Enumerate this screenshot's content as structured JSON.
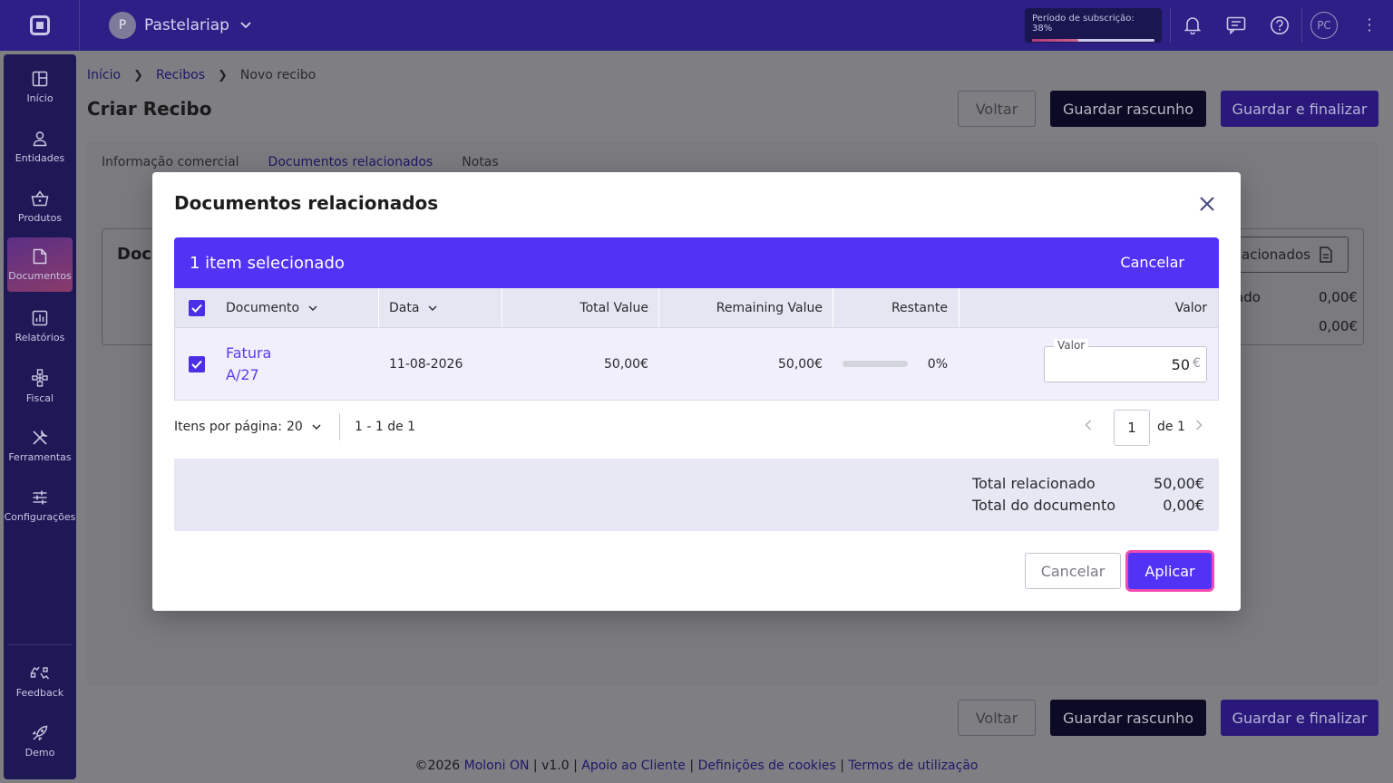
{
  "topbar": {
    "company_initial": "P",
    "company_name": "Pastelariap",
    "subscription_label": "Período de subscrição: 38%",
    "subscription_progress": 0.38,
    "user_initials": "PC"
  },
  "sidebar": {
    "items": [
      {
        "label": "Início",
        "icon": "dashboard-icon"
      },
      {
        "label": "Entidades",
        "icon": "user-icon"
      },
      {
        "label": "Produtos",
        "icon": "basket-icon"
      },
      {
        "label": "Documentos",
        "icon": "document-icon"
      },
      {
        "label": "Relatórios",
        "icon": "chart-icon"
      },
      {
        "label": "Fiscal",
        "icon": "hierarchy-icon"
      },
      {
        "label": "Ferramentas",
        "icon": "tools-icon"
      },
      {
        "label": "Configurações",
        "icon": "sliders-icon"
      }
    ],
    "bottom": [
      {
        "label": "Feedback",
        "icon": "feedback-icon"
      },
      {
        "label": "Demo",
        "icon": "rocket-icon"
      }
    ]
  },
  "page": {
    "breadcrumb": [
      "Início",
      "Recibos",
      "Novo recibo"
    ],
    "title": "Criar Recibo",
    "btn_back": "Voltar",
    "btn_draft": "Guardar rascunho",
    "btn_finalize": "Guardar e finalizar",
    "tabs": [
      "Informação comercial",
      "Documentos relacionados",
      "Notas"
    ],
    "card_title_partial": "Docu",
    "related_btn_partial": "acionados",
    "bg_text_partial": "ado",
    "bg_value_1": "0,00€",
    "bg_value_2": "0,00€"
  },
  "modal": {
    "title": "Documentos relacionados",
    "selection_text": "1 item selecionado",
    "selection_cancel": "Cancelar",
    "columns": {
      "documento": "Documento",
      "data": "Data",
      "total_value": "Total Value",
      "remaining_value": "Remaining Value",
      "restante": "Restante",
      "valor": "Valor"
    },
    "rows": [
      {
        "doc_line1": "Fatura",
        "doc_line2": "A/27",
        "date": "11-08-2026",
        "total_value": "50,00€",
        "remaining_value": "50,00€",
        "restante_pct": "0%",
        "restante_fraction": 0.0,
        "valor_label": "Valor",
        "valor_value": "50",
        "valor_unit": "€"
      }
    ],
    "pager": {
      "items_label": "Itens por página:",
      "per_page": "20",
      "range": "1 - 1 de 1",
      "page": "1",
      "of_label": "de 1"
    },
    "totals": {
      "related_label": "Total relacionado",
      "related_value": "50,00€",
      "document_label": "Total do documento",
      "document_value": "0,00€"
    },
    "btn_cancel": "Cancelar",
    "btn_apply": "Aplicar"
  },
  "footer": {
    "copyright": "©2026",
    "brand": "Moloni ON",
    "version": "v1.0",
    "support": "Apoio ao Cliente",
    "cookies": "Definições de cookies",
    "terms": "Termos de utilização"
  }
}
